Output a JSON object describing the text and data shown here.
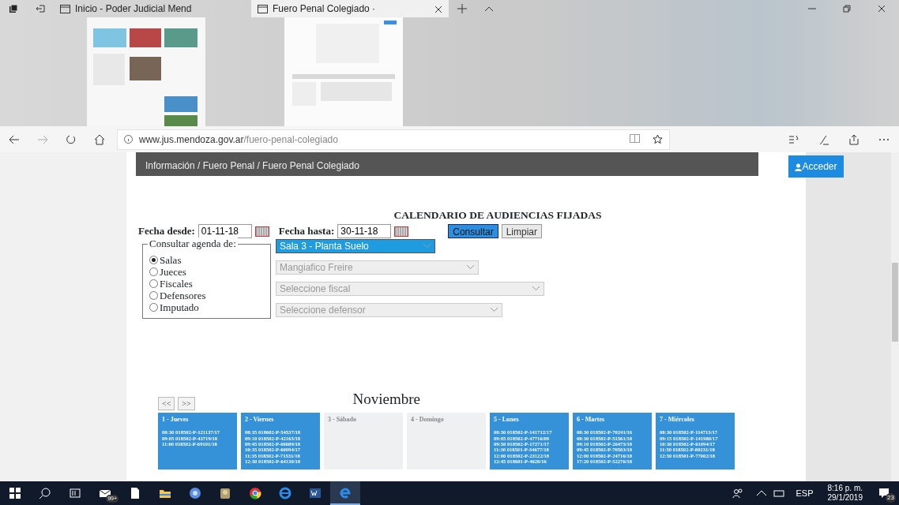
{
  "browser": {
    "tabs": [
      {
        "title": "Inicio - Poder Judicial Mend",
        "selected": false
      },
      {
        "title": "Fuero Penal Colegiado ·",
        "selected": true
      }
    ],
    "address": {
      "host": "www.jus.mendoza.gov.ar",
      "path": "/fuero-penal-colegiado"
    }
  },
  "page": {
    "breadcrumb": "Información / Fuero Penal / Fuero Penal Colegiado",
    "login_button": "Acceder",
    "title": "CALENDARIO DE AUDIENCIAS FIJADAS",
    "date_from": {
      "label": "Fecha desde:",
      "value": "01-11-18"
    },
    "date_to": {
      "label": "Fecha hasta:",
      "value": "30-11-18"
    },
    "buttons": [
      {
        "label": "Consultar",
        "kind": "primary"
      },
      {
        "label": "Limpiar",
        "kind": "secondary"
      }
    ],
    "agenda": {
      "legend": "Consultar agenda de:",
      "options": [
        {
          "label": "Salas",
          "selected": true
        },
        {
          "label": "Jueces",
          "selected": false
        },
        {
          "label": "Fiscales",
          "selected": false
        },
        {
          "label": "Defensores",
          "selected": false
        },
        {
          "label": "Imputado",
          "selected": false
        }
      ]
    },
    "selects": [
      {
        "value": "Sala 3 - Planta Suelo",
        "disabled": false
      },
      {
        "value": "Mangiafico Freire",
        "disabled": true
      },
      {
        "value": "Seleccione fiscal",
        "disabled": true
      },
      {
        "value": "Seleccione defensor",
        "disabled": true
      }
    ],
    "calendar": {
      "nav": [
        "<<",
        ">>"
      ],
      "month": "Noviembre",
      "days": [
        {
          "title": "1 - Jueves",
          "busy": true,
          "entries": [
            "08:30 018502-P-121137/17",
            "09:05 018502-P-43719/18",
            "11:00 018502-P-69101/18"
          ]
        },
        {
          "title": "2 - Viernes",
          "busy": true,
          "entries": [
            "08:35 018602-P-54537/18",
            "09:10 018502-P-42165/18",
            "09:45 018502-P-60689/18",
            "10:35 018502-P-60094/17",
            "11:35 018502-P-71531/18",
            "12:30 018502-P-64130/18"
          ]
        },
        {
          "title": "3 - Sábado",
          "busy": false
        },
        {
          "title": "4 - Domingo",
          "busy": false
        },
        {
          "title": "5 - Lunes",
          "busy": true,
          "entries": [
            "08:30 018502-P-141712/17",
            "09:05 018502-P-47716/09",
            "09:50 018502-P-17271/17",
            "11:30 018501-P-34677/18",
            "12:00 018502-P-23122/18",
            "12:45 018601-P-4628/16"
          ]
        },
        {
          "title": "6 - Martes",
          "busy": true,
          "entries": [
            "08:30 018502-P-70241/16",
            "08:30 018502-P-51561/18",
            "09:10 018502-P-26475/18",
            "09:45 018502-P-70503/18",
            "12:00 018502-P-24716/18",
            "17:20 018502-P-52276/18"
          ]
        },
        {
          "title": "7 - Miércoles",
          "busy": true,
          "entries": [
            "08:30 018502-P-114713/17",
            "09:15 018502-P-141980/17",
            "10:30 018502-P-61094/17",
            "11:50 018502-P-80231/18",
            "12:50 018501-P-77002/18"
          ]
        }
      ]
    }
  },
  "taskbar": {
    "mail_badge": "99+",
    "language": "ESP",
    "time": "8:16 p. m.",
    "date": "29/1/2019",
    "notifications": "23"
  }
}
